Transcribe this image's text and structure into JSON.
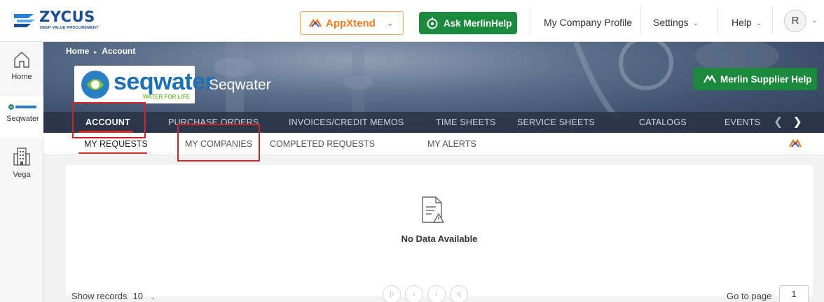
{
  "topbar": {
    "logo_text": "ZYCUS",
    "logo_tagline": "DEEP VALUE PROCUREMENT",
    "appxtend_label": "AppXtend",
    "merlin_help_label": "Ask MerlinHelp",
    "company_profile_label": "My Company Profile",
    "settings_label": "Settings",
    "help_label": "Help",
    "avatar_initial": "R"
  },
  "sidebar": {
    "items": [
      {
        "label": "Home",
        "icon": "home-icon"
      },
      {
        "label": "Seqwater",
        "icon": "seqwater-logo"
      },
      {
        "label": "Vega",
        "icon": "building-icon"
      }
    ]
  },
  "banner": {
    "breadcrumb": [
      "Home",
      "Account"
    ],
    "supplier_logo_text": "seqwater",
    "supplier_logo_tagline": "WATER FOR LIFE",
    "supplier_name": "Seqwater",
    "merlin_supplier_help_label": "Merlin Supplier Help"
  },
  "tabs": [
    "ACCOUNT",
    "PURCHASE ORDERS",
    "INVOICES/CREDIT MEMOS",
    "TIME SHEETS",
    "SERVICE SHEETS",
    "CATALOGS",
    "EVENTS"
  ],
  "active_tab": "ACCOUNT",
  "subtabs": [
    "MY REQUESTS",
    "MY COMPANIES",
    "COMPLETED REQUESTS",
    "MY ALERTS"
  ],
  "active_subtab": "MY REQUESTS",
  "content": {
    "empty_message": "No Data Available"
  },
  "footer": {
    "show_records_label": "Show records",
    "show_records_value": "10",
    "goto_label": "Go to page",
    "goto_value": "1"
  },
  "colors": {
    "brand_blue": "#1b4c8f",
    "appxtend_orange": "#f47b20",
    "merlin_green": "#1c8a3c",
    "highlight_red": "#d4222a"
  }
}
